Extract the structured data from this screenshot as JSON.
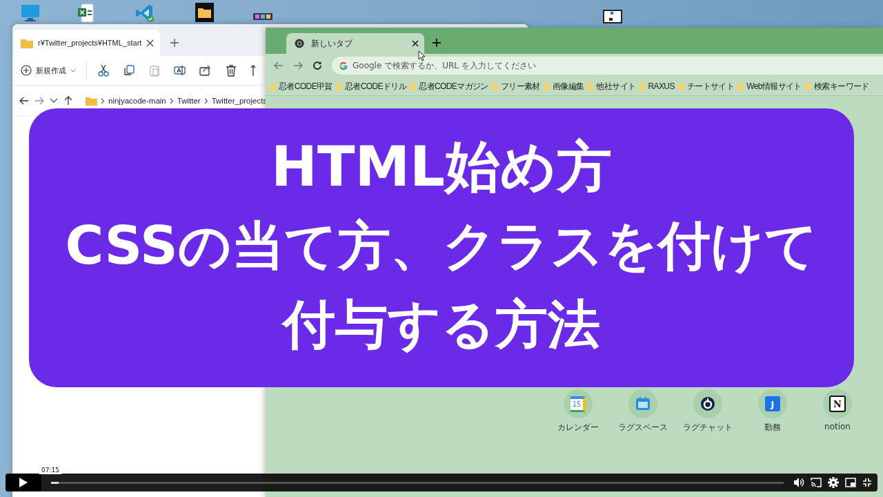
{
  "explorer": {
    "tab_title": "r¥Twitter_projects¥HTML_start",
    "new_button": "新規作成",
    "breadcrumb": [
      "ninjyacode-main",
      "Twitter",
      "Twitter_projects"
    ]
  },
  "browser": {
    "tab_title": "新しいタブ",
    "address_bar": {
      "placeholder": "Google で検索するか、URL を入力してください"
    },
    "bookmarks": [
      "忍者CODE甲賀",
      "忍者CODEドリル",
      "忍者CODEマガジン",
      "フリー素材",
      "画像編集",
      "他社サイト",
      "RAXUS",
      "チートサイト",
      "Web情報サイト",
      "検索キーワード"
    ],
    "shortcuts": [
      {
        "label": "カレンダー",
        "kind": "calendar",
        "glyph": "15"
      },
      {
        "label": "ラグスペース",
        "kind": "window"
      },
      {
        "label": "ラグチャット",
        "kind": "ring"
      },
      {
        "label": "勤務",
        "kind": "tile",
        "glyph": "J"
      },
      {
        "label": "notion",
        "kind": "notion",
        "glyph": "N"
      }
    ]
  },
  "overlay": {
    "lines": [
      "HTML始め方",
      "CSSの当て方、クラスを付けて",
      "付与する方法"
    ]
  },
  "player": {
    "time_tooltip": "07:15",
    "progress": {
      "level": 0.01
    }
  }
}
